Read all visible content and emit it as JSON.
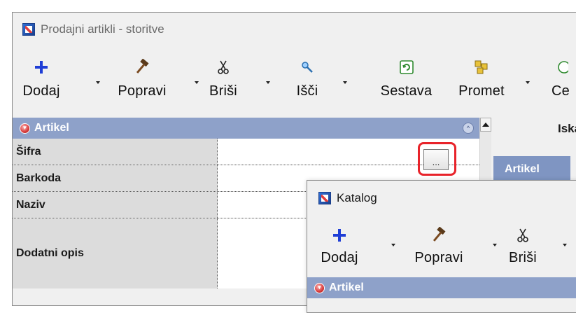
{
  "window": {
    "title": "Prodajni artikli - storitve",
    "icon": "app-icon"
  },
  "toolbar": {
    "items": [
      {
        "label": "Dodaj",
        "icon": "plus-icon"
      },
      {
        "label": "Popravi",
        "icon": "hammer-icon"
      },
      {
        "label": "Briši",
        "icon": "scissors-icon"
      },
      {
        "label": "Išči",
        "icon": "magnifier-icon"
      },
      {
        "label": "Sestava",
        "icon": "sestava-icon"
      },
      {
        "label": "Promet",
        "icon": "promet-icon"
      },
      {
        "label": "Ce",
        "icon": "green-icon"
      }
    ]
  },
  "panel": {
    "title": "Artikel",
    "fields": [
      {
        "label": "Šifra",
        "value": ""
      },
      {
        "label": "Barkoda",
        "value": ""
      },
      {
        "label": "Naziv",
        "value": ""
      },
      {
        "label": "Dodatni opis",
        "value": ""
      }
    ],
    "ellipsis_label": "..."
  },
  "right": {
    "header": "Iska",
    "tab": "Artikel"
  },
  "catalog": {
    "title": "Katalog",
    "toolbar": [
      {
        "label": "Dodaj",
        "icon": "plus-icon"
      },
      {
        "label": "Popravi",
        "icon": "hammer-icon"
      },
      {
        "label": "Briši",
        "icon": "scissors-icon"
      }
    ],
    "panel_title": "Artikel"
  },
  "colors": {
    "panel_header": "#8ea1c9",
    "highlight": "#e8232a",
    "plus": "#1f3ed6"
  }
}
